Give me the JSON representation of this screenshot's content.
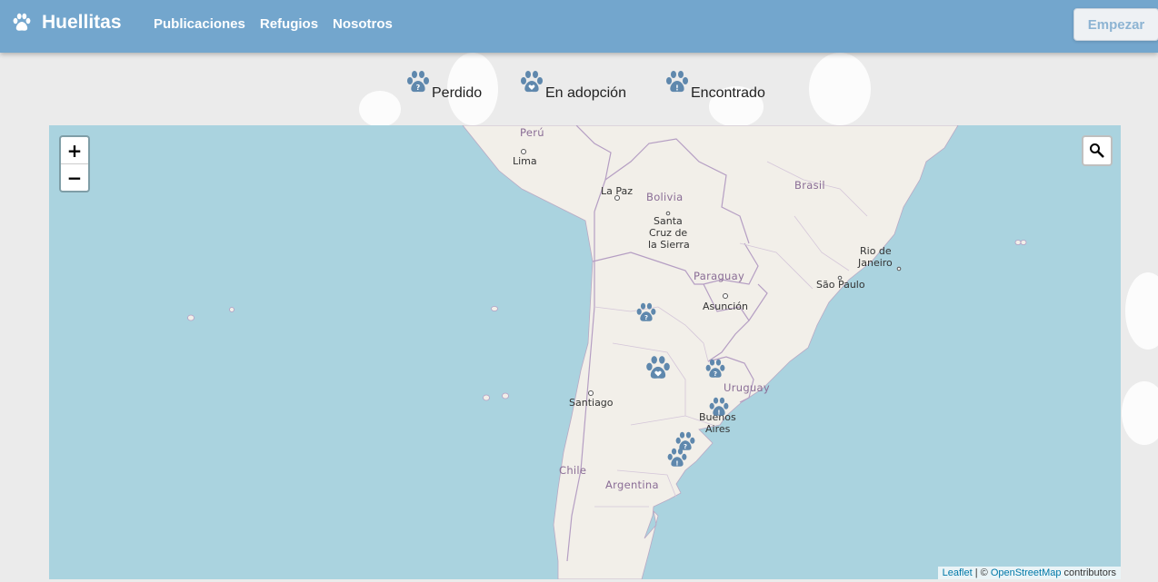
{
  "brand": {
    "name": "Huellitas",
    "icon": "paw-icon"
  },
  "nav": {
    "links": [
      "Publicaciones",
      "Refugios",
      "Nosotros"
    ]
  },
  "header": {
    "start_button": "Empezar"
  },
  "legend": [
    {
      "label": "Perdido",
      "icon": "paw-question-icon"
    },
    {
      "label": "En adopción",
      "icon": "paw-heart-icon"
    },
    {
      "label": "Encontrado",
      "icon": "paw-exclamation-icon"
    }
  ],
  "map": {
    "zoom_in": "+",
    "zoom_out": "−",
    "attribution": {
      "leaflet": "Leaflet",
      "separator": " | © ",
      "osm": "OpenStreetMap",
      "suffix": " contributors"
    },
    "places": {
      "peru": "Perú",
      "lima": "Lima",
      "la_paz": "La Paz",
      "bolivia": "Bolivia",
      "santa_cruz_1": "Santa",
      "santa_cruz_2": "Cruz de",
      "santa_cruz_3": "la Sierra",
      "brasil": "Brasil",
      "rio_1": "Rio de",
      "rio_2": "Janeiro",
      "sao_paulo": "São Paulo",
      "paraguay": "Paraguay",
      "asuncion": "Asunción",
      "santiago": "Santiago",
      "uruguay": "Uruguay",
      "ba_1": "Buenos",
      "ba_2": "Aires",
      "chile": "Chile",
      "argentina": "Argentina"
    }
  },
  "colors": {
    "navbar": "#73a6cd",
    "marker": "#5f88ad",
    "sea": "#aad3df",
    "land": "#f2efe9"
  }
}
